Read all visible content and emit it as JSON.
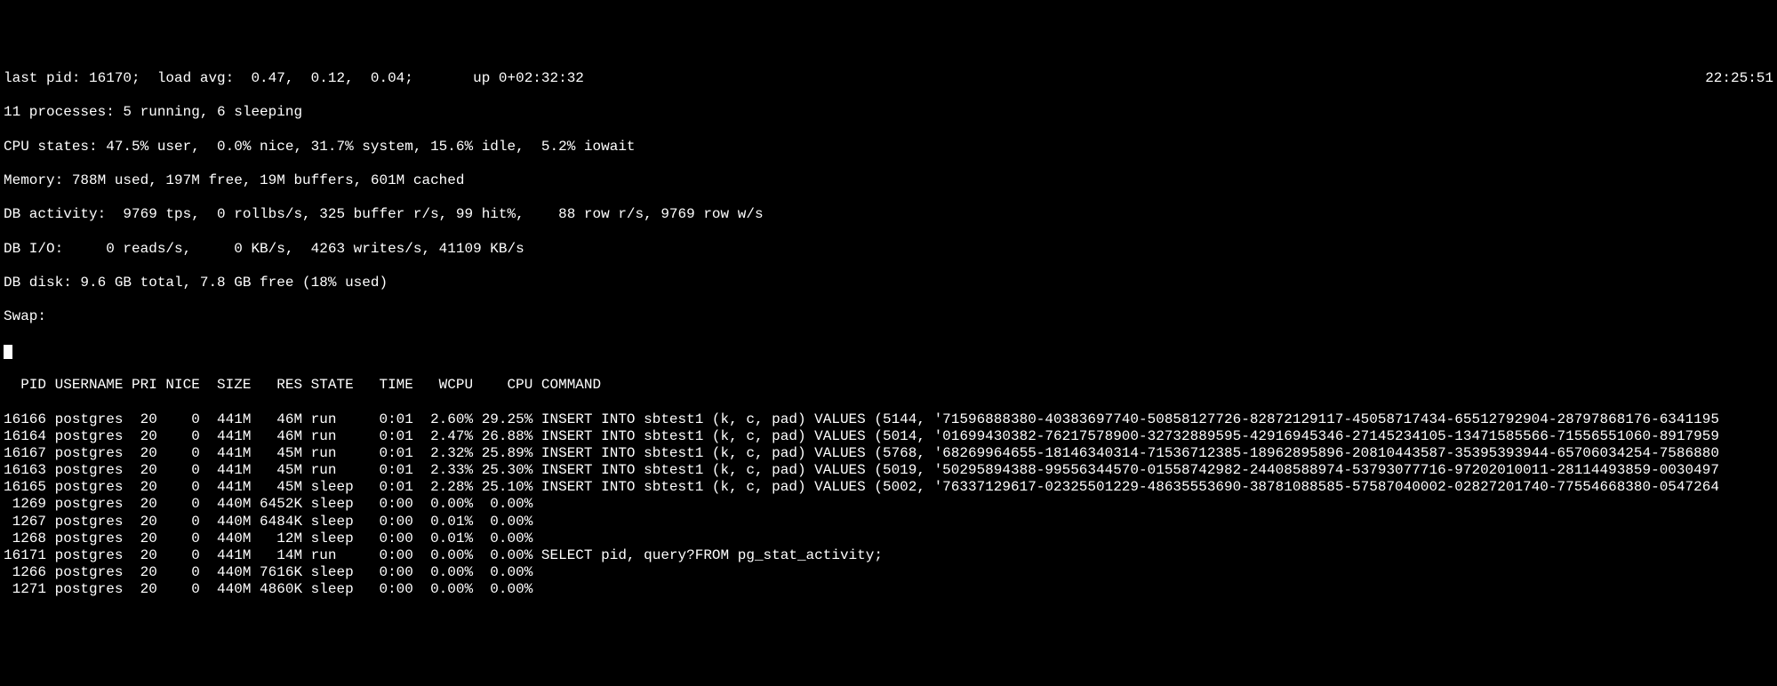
{
  "header": {
    "line1_left": "last pid: 16170;  load avg:  0.47,  0.12,  0.04;       up 0+02:32:32",
    "line1_right": "22:25:51",
    "line2": "11 processes: 5 running, 6 sleeping",
    "line3": "CPU states: 47.5% user,  0.0% nice, 31.7% system, 15.6% idle,  5.2% iowait",
    "line4": "Memory: 788M used, 197M free, 19M buffers, 601M cached",
    "line5": "DB activity:  9769 tps,  0 rollbs/s, 325 buffer r/s, 99 hit%,    88 row r/s, 9769 row w/s",
    "line6": "DB I/O:     0 reads/s,     0 KB/s,  4263 writes/s, 41109 KB/s",
    "line7": "DB disk: 9.6 GB total, 7.8 GB free (18% used)",
    "line8": "Swap: "
  },
  "columns": "  PID USERNAME PRI NICE  SIZE   RES STATE   TIME   WCPU    CPU COMMAND",
  "chart_data": {
    "type": "table",
    "columns": [
      "PID",
      "USERNAME",
      "PRI",
      "NICE",
      "SIZE",
      "RES",
      "STATE",
      "TIME",
      "WCPU",
      "CPU",
      "COMMAND"
    ],
    "rows": [
      [
        "16166",
        "postgres",
        "20",
        "0",
        "441M",
        "46M",
        "run",
        "0:01",
        "2.60%",
        "29.25%",
        "INSERT INTO sbtest1 (k, c, pad) VALUES (5144, '71596888380-40383697740-50858127726-82872129117-45058717434-65512792904-28797868176-6341195"
      ],
      [
        "16164",
        "postgres",
        "20",
        "0",
        "441M",
        "46M",
        "run",
        "0:01",
        "2.47%",
        "26.88%",
        "INSERT INTO sbtest1 (k, c, pad) VALUES (5014, '01699430382-76217578900-32732889595-42916945346-27145234105-13471585566-71556551060-8917959"
      ],
      [
        "16167",
        "postgres",
        "20",
        "0",
        "441M",
        "45M",
        "run",
        "0:01",
        "2.32%",
        "25.89%",
        "INSERT INTO sbtest1 (k, c, pad) VALUES (5768, '68269964655-18146340314-71536712385-18962895896-20810443587-35395393944-65706034254-7586880"
      ],
      [
        "16163",
        "postgres",
        "20",
        "0",
        "441M",
        "45M",
        "run",
        "0:01",
        "2.33%",
        "25.30%",
        "INSERT INTO sbtest1 (k, c, pad) VALUES (5019, '50295894388-99556344570-01558742982-24408588974-53793077716-97202010011-28114493859-0030497"
      ],
      [
        "16165",
        "postgres",
        "20",
        "0",
        "441M",
        "45M",
        "sleep",
        "0:01",
        "2.28%",
        "25.10%",
        "INSERT INTO sbtest1 (k, c, pad) VALUES (5002, '76337129617-02325501229-48635553690-38781088585-57587040002-02827201740-77554668380-0547264"
      ],
      [
        "1269",
        "postgres",
        "20",
        "0",
        "440M",
        "6452K",
        "sleep",
        "0:00",
        "0.00%",
        "0.00%",
        ""
      ],
      [
        "1267",
        "postgres",
        "20",
        "0",
        "440M",
        "6484K",
        "sleep",
        "0:00",
        "0.01%",
        "0.00%",
        ""
      ],
      [
        "1268",
        "postgres",
        "20",
        "0",
        "440M",
        "12M",
        "sleep",
        "0:00",
        "0.01%",
        "0.00%",
        ""
      ],
      [
        "16171",
        "postgres",
        "20",
        "0",
        "441M",
        "14M",
        "run",
        "0:00",
        "0.00%",
        "0.00%",
        "SELECT pid, query?FROM pg_stat_activity;"
      ],
      [
        "1266",
        "postgres",
        "20",
        "0",
        "440M",
        "7616K",
        "sleep",
        "0:00",
        "0.00%",
        "0.00%",
        ""
      ],
      [
        "1271",
        "postgres",
        "20",
        "0",
        "440M",
        "4860K",
        "sleep",
        "0:00",
        "0.00%",
        "0.00%",
        ""
      ]
    ]
  },
  "rows_formatted": [
    "16166 postgres  20    0  441M   46M run     0:01  2.60% 29.25% INSERT INTO sbtest1 (k, c, pad) VALUES (5144, '71596888380-40383697740-50858127726-82872129117-45058717434-65512792904-28797868176-6341195",
    "16164 postgres  20    0  441M   46M run     0:01  2.47% 26.88% INSERT INTO sbtest1 (k, c, pad) VALUES (5014, '01699430382-76217578900-32732889595-42916945346-27145234105-13471585566-71556551060-8917959",
    "16167 postgres  20    0  441M   45M run     0:01  2.32% 25.89% INSERT INTO sbtest1 (k, c, pad) VALUES (5768, '68269964655-18146340314-71536712385-18962895896-20810443587-35395393944-65706034254-7586880",
    "16163 postgres  20    0  441M   45M run     0:01  2.33% 25.30% INSERT INTO sbtest1 (k, c, pad) VALUES (5019, '50295894388-99556344570-01558742982-24408588974-53793077716-97202010011-28114493859-0030497",
    "16165 postgres  20    0  441M   45M sleep   0:01  2.28% 25.10% INSERT INTO sbtest1 (k, c, pad) VALUES (5002, '76337129617-02325501229-48635553690-38781088585-57587040002-02827201740-77554668380-0547264",
    " 1269 postgres  20    0  440M 6452K sleep   0:00  0.00%  0.00% ",
    " 1267 postgres  20    0  440M 6484K sleep   0:00  0.01%  0.00% ",
    " 1268 postgres  20    0  440M   12M sleep   0:00  0.01%  0.00% ",
    "16171 postgres  20    0  441M   14M run     0:00  0.00%  0.00% SELECT pid, query?FROM pg_stat_activity;",
    " 1266 postgres  20    0  440M 7616K sleep   0:00  0.00%  0.00% ",
    " 1271 postgres  20    0  440M 4860K sleep   0:00  0.00%  0.00% "
  ]
}
